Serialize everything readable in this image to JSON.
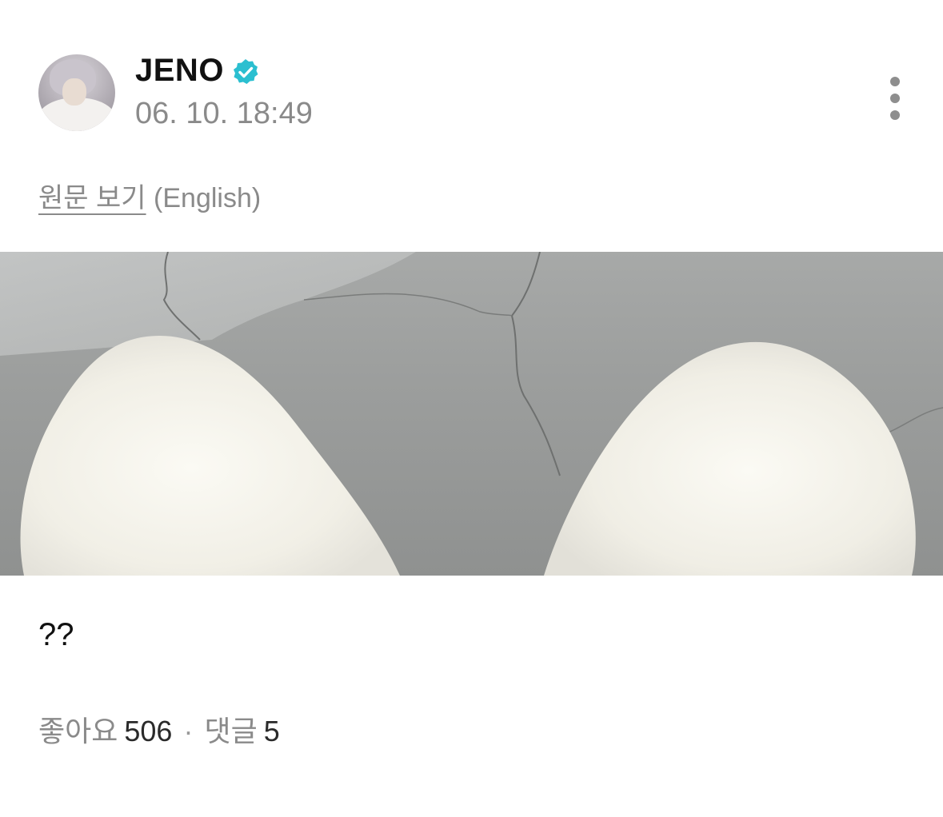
{
  "post": {
    "author": {
      "name": "JENO",
      "verified_color": "#2bbfd0",
      "avatar_icon": "profile-photo"
    },
    "timestamp": "06. 10. 18:49",
    "translate": {
      "link_label": "원문 보기",
      "language": "(English)"
    },
    "body_text": "??",
    "stats": {
      "likes_label": "좋아요",
      "likes_count": "506",
      "separator": "·",
      "comments_label": "댓글",
      "comments_count": "5"
    },
    "more_icon": "more-vertical-icon"
  },
  "colors": {
    "text_primary": "#111111",
    "text_secondary": "#8a8a8a",
    "background": "#ffffff"
  }
}
